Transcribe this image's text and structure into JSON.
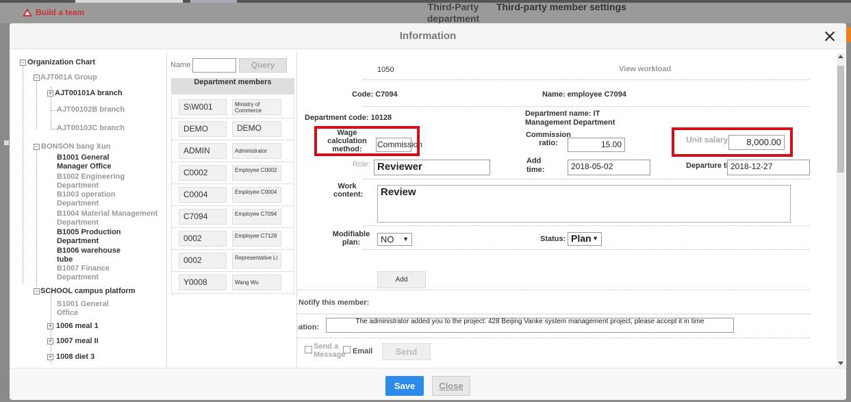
{
  "background": {
    "brand": "Build a team",
    "header_department": "Third-Party department settings",
    "header_member": "Third-party member settings"
  },
  "modal": {
    "title": "Information",
    "save_label": "Save",
    "close_label": "Close"
  },
  "org_tree": {
    "root": "Organization Chart",
    "nodes": [
      "AJT001A Group",
      "AJT00101A branch",
      "AJT00102B branch",
      "AJT00103C branch",
      "BONSON bang Xun",
      "B1001 General Manager Office",
      "B1002 Engineering Department",
      "B1003 operation Department",
      "B1004 Material Management Department",
      "B1005 Production Department",
      "B1006 warehouse tube",
      "B1007 Finance Department",
      "SCHOOL campus platform",
      "S1001 General Office",
      "1006 meal 1",
      "1007 meal II",
      "1008 diet 3"
    ]
  },
  "members": {
    "name_label": "Name",
    "query_label": "Query",
    "header": "Department members",
    "rows": [
      {
        "code": "S\\W001",
        "desc": "Ministry of Commerce"
      },
      {
        "code": "DEMO",
        "desc": "DEMO"
      },
      {
        "code": "ADMIN",
        "desc": "Administrator"
      },
      {
        "code": "C0002",
        "desc": "Employee C0002"
      },
      {
        "code": "C0004",
        "desc": "Employee C0004"
      },
      {
        "code": "C7094",
        "desc": "Employee C7094"
      },
      {
        "code": "0002",
        "desc": "Employee C7128"
      },
      {
        "code": "0002",
        "desc": "Representative Li"
      },
      {
        "code": "Y0008",
        "desc": "Wang Wu"
      }
    ]
  },
  "form": {
    "id_value": "1050",
    "view_workload": "View workload",
    "code": "Code: C7094",
    "name": "Name: employee C7094",
    "dept_code": "Department code: 10128",
    "dept_name": "Department name: IT Management Department",
    "wage_label": "Wage calculation method:",
    "wage_value": "Commission",
    "commission_label": "Commission ratio:",
    "commission_value": "15.00",
    "unit_salary_label": "Unit salary:",
    "unit_salary_value": "8,000.00",
    "role_label": "Role:",
    "role_value": "Reviewer",
    "add_time_label": "Add time:",
    "add_time_value": "2018-05-02",
    "departure_label": "Departure time:",
    "departure_value": "2018-12-27",
    "work_content_label": "Work content:",
    "work_content_value": "Review",
    "modifiable_label": "Modifiable plan:",
    "modifiable_value": "NO",
    "status_label": "Status:",
    "status_value": "Plan",
    "add_label": "Add",
    "notify_label": "Notify this member:",
    "information_label": "Information:",
    "information_value": "The administrator added you to the project: 428 Beijing Vanke system management project, please accept it in time",
    "send_message_label": "Send a Message",
    "email_label": "Email",
    "send_label": "Send"
  },
  "colors": {
    "highlight": "#d0111b",
    "save_button": "#2c8ae8"
  }
}
